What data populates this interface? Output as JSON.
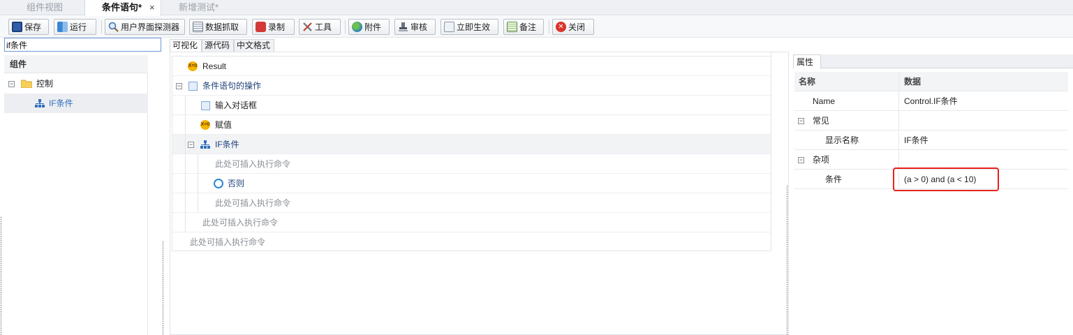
{
  "doc_tabs": [
    {
      "label": "组件视图",
      "active": false
    },
    {
      "label": "条件语句*",
      "active": true,
      "close": "×"
    },
    {
      "label": "新增测试*",
      "active": false
    }
  ],
  "toolbar": {
    "save": "保存",
    "run": "运行",
    "ui_detector": "用户界面探测器",
    "data_capture": "数据抓取",
    "record": "录制",
    "tools": "工具",
    "attachment": "附件",
    "review": "审核",
    "apply_now": "立即生效",
    "notes": "备注",
    "close": "关闭"
  },
  "left_panel": {
    "search_value": "if条件",
    "header": "组件",
    "tree": [
      {
        "label": "控制",
        "icon": "folder-icon",
        "expander": "−"
      },
      {
        "label": "IF条件",
        "icon": "if-condition-icon"
      }
    ]
  },
  "view_tabs": [
    "可视化",
    "源代码",
    "中文格式"
  ],
  "flow": {
    "rows": [
      {
        "label": "Result",
        "icon": "assign-icon"
      },
      {
        "label": "条件语句的操作",
        "icon": "sequence-icon",
        "expander": "−"
      },
      {
        "label": "输入对话框",
        "icon": "dialog-icon"
      },
      {
        "label": "赋值",
        "icon": "assign-icon"
      },
      {
        "label": "IF条件",
        "icon": "if-condition-icon",
        "expander": "−"
      },
      {
        "label": "此处可插入执行命令"
      },
      {
        "label": "否则",
        "icon": "else-icon"
      },
      {
        "label": "此处可插入执行命令"
      },
      {
        "label": "此处可插入执行命令"
      },
      {
        "label": "此处可插入执行命令"
      }
    ],
    "assign_glyph": "X=0"
  },
  "properties": {
    "tab": "属性",
    "col_name": "名称",
    "col_data": "数据",
    "rows": [
      {
        "name": "Name",
        "value": "Control.IF条件"
      },
      {
        "name": "常见",
        "value": "",
        "group": true,
        "expander": "−"
      },
      {
        "name": "显示名称",
        "value": "IF条件"
      },
      {
        "name": "杂项",
        "value": "",
        "group": true,
        "expander": "−"
      },
      {
        "name": "条件",
        "value": "(a > 0) and (a < 10)"
      }
    ]
  },
  "colors": {
    "accent_blue": "#2f6fbf",
    "highlight_red": "#e5221b"
  }
}
